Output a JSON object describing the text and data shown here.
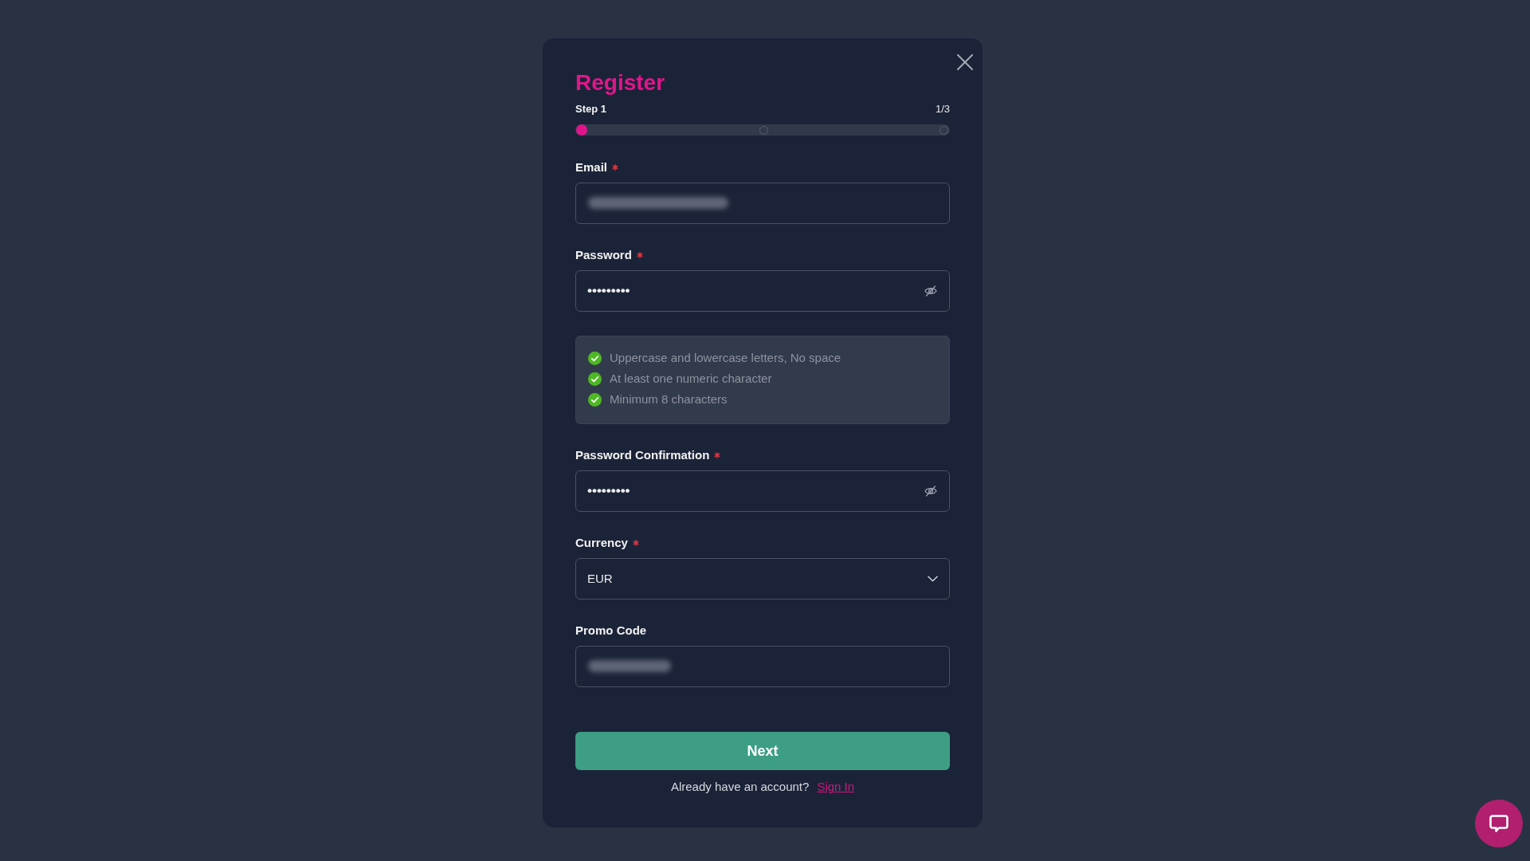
{
  "dialog": {
    "title": "Register",
    "step_label": "Step 1",
    "step_count": "1/3",
    "steps": [
      {
        "active": true
      },
      {
        "active": false
      },
      {
        "active": false
      }
    ],
    "form": [
      {
        "kind": "text",
        "label": "Email",
        "required": true,
        "blurred": true
      },
      {
        "kind": "password",
        "label": "Password",
        "required": true,
        "value": "•••••••••",
        "revealed": false
      },
      {
        "kind": "rules",
        "items": [
          {
            "text": "Uppercase and lowercase letters, No space",
            "met": true
          },
          {
            "text": "At least one numeric character",
            "met": true
          },
          {
            "text": "Minimum 8 characters",
            "met": true
          }
        ]
      },
      {
        "kind": "password",
        "label": "Password Confirmation",
        "required": true,
        "value": "•••••••••",
        "revealed": false
      },
      {
        "kind": "select",
        "label": "Currency",
        "required": true,
        "value": "EUR"
      },
      {
        "kind": "text",
        "label": "Promo Code",
        "required": false,
        "blurred": true
      }
    ],
    "submit": "Next",
    "footer": {
      "text": "Already have an account?",
      "link": "Sign In"
    }
  }
}
